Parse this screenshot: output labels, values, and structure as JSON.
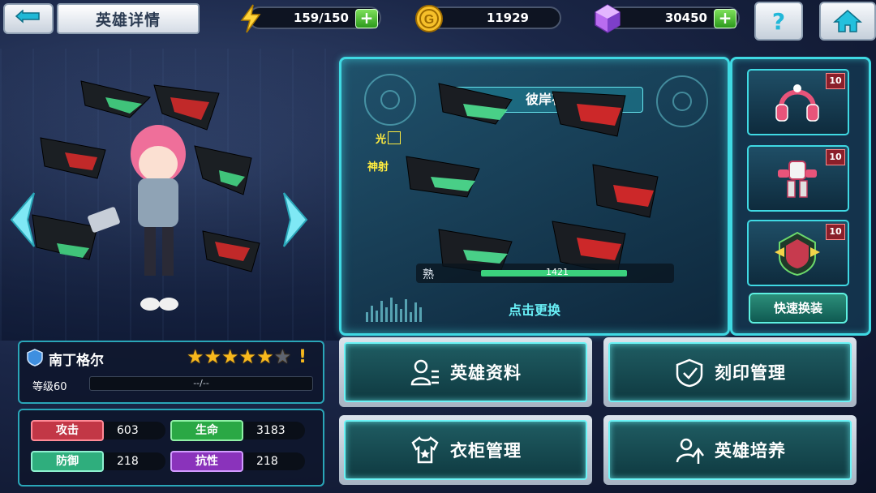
{
  "header": {
    "title": "英雄详情",
    "energy": "159/150",
    "gold": "11929",
    "gems": "30450"
  },
  "hero": {
    "name": "南丁格尔",
    "stars": 5,
    "max_stars": 6,
    "level_label": "等级60",
    "exp_text": "--/--"
  },
  "stats": [
    {
      "label": "攻击",
      "value": "603",
      "color": "#d04552"
    },
    {
      "label": "生命",
      "value": "3183",
      "color": "#35b653"
    },
    {
      "label": "防御",
      "value": "218",
      "color": "#3fbf8b"
    },
    {
      "label": "抗性",
      "value": "218",
      "color": "#9b3fc8"
    }
  ],
  "weapon_panel": {
    "item_name": "彼岸花",
    "attr_1": "光",
    "attr_2": "神射",
    "progress_label": "熟",
    "progress_text": "1421",
    "change_label": "点击更换"
  },
  "equipment": {
    "slots": [
      {
        "name": "headphones-accessory",
        "level": "10"
      },
      {
        "name": "mech-body-equipment",
        "level": "10"
      },
      {
        "name": "emblem-equipment",
        "level": "10"
      }
    ],
    "quick_swap_label": "快速换装"
  },
  "menu": {
    "hero_info": "英雄资料",
    "imprint_manage": "刻印管理",
    "wardrobe_manage": "衣柜管理",
    "hero_train": "英雄培养"
  },
  "colors": {
    "accent": "#3fd9e3",
    "star": "#f7b81d"
  }
}
